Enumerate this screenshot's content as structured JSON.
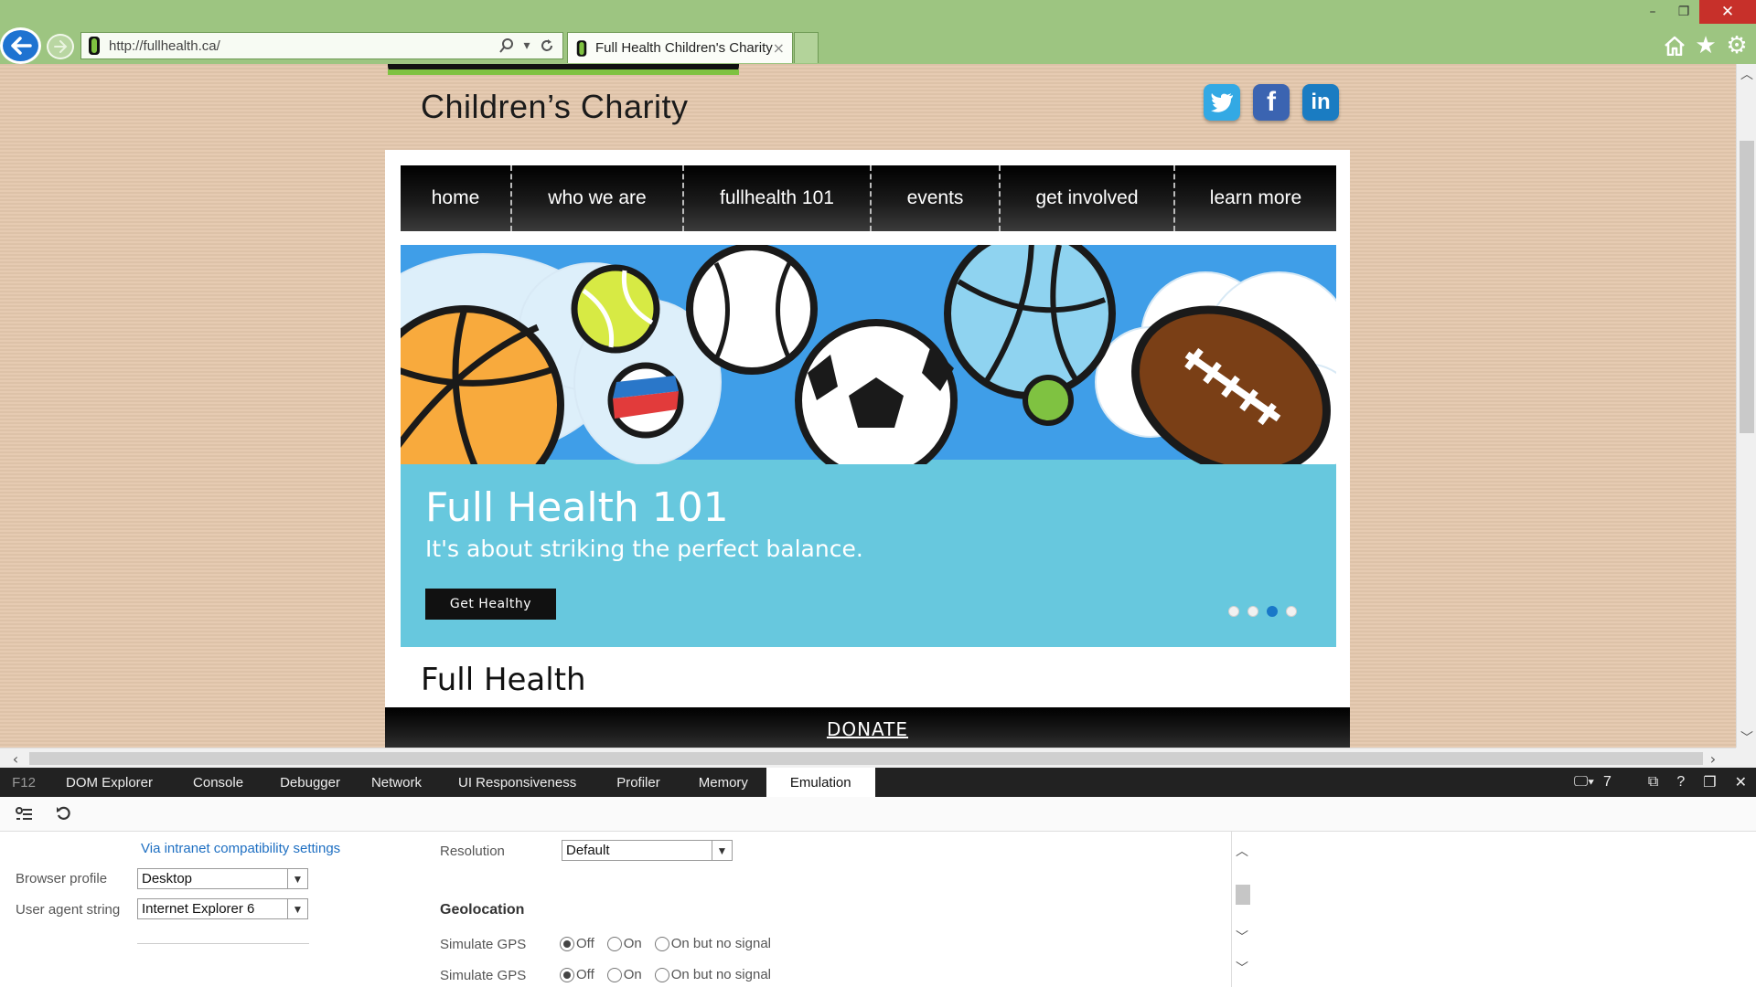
{
  "browser": {
    "url": "http://fullhealth.ca/",
    "tab_title": "Full Health Children's Charity",
    "tab_close": "×",
    "window_controls": {
      "minimize": "–",
      "restore": "❐",
      "close": "✕"
    },
    "toolbar_icons": [
      "home-icon",
      "favorites-star-icon",
      "settings-gear-icon"
    ]
  },
  "page": {
    "logo_subtitle": "Children’s Charity",
    "social": {
      "facebook": "f",
      "linkedin": "in"
    },
    "nav": [
      "home",
      "who we are",
      "fullhealth 101",
      "events",
      "get involved",
      "learn more"
    ],
    "hero": {
      "title": "Full Health 101",
      "subtitle": "It's about striking the perfect balance.",
      "button": "Get Healthy",
      "slides": 4,
      "active_slide": 3
    },
    "section_title": "Full Health",
    "donate": "DONATE"
  },
  "devtools": {
    "f12": "F12",
    "tabs": [
      "DOM Explorer",
      "Console",
      "Debugger",
      "Network",
      "UI Responsiveness",
      "Profiler",
      "Memory",
      "Emulation"
    ],
    "active_tab": "Emulation",
    "document_mode": "7",
    "help": "?",
    "compat_link": "Via intranet compatibility settings",
    "browser_profile_label": "Browser profile",
    "browser_profile_value": "Desktop",
    "user_agent_label": "User agent string",
    "user_agent_value": "Internet Explorer 6",
    "resolution_label": "Resolution",
    "resolution_value": "Default",
    "geolocation_heading": "Geolocation",
    "gps_rows": [
      {
        "label": "Simulate GPS",
        "options": [
          "Off",
          "On",
          "On but no signal"
        ],
        "selected": "Off"
      },
      {
        "label": "Simulate GPS",
        "options": [
          "Off",
          "On",
          "On but no signal"
        ],
        "selected": "Off"
      }
    ]
  },
  "colors": {
    "chrome": "#9dc581",
    "page_background": "#e4c8ad",
    "hero_band": "#67c8de",
    "hero_sky": "#3f9ee8",
    "link": "#1e6fc2"
  }
}
